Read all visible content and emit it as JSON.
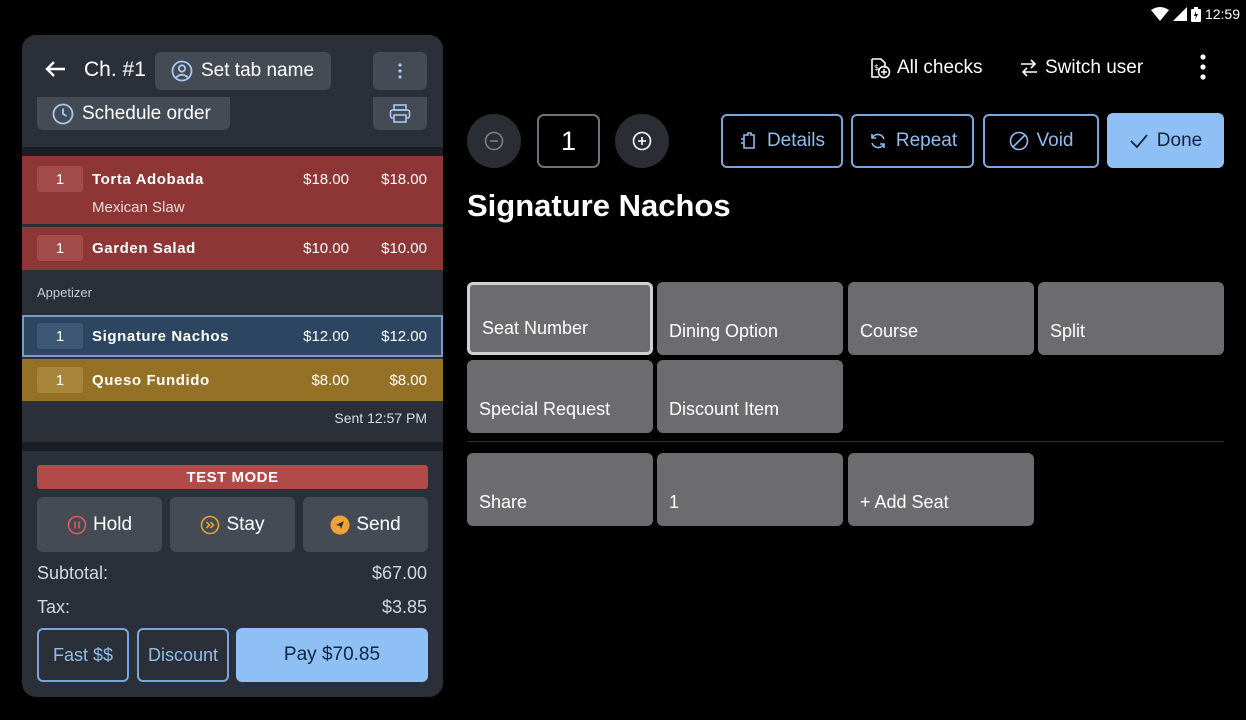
{
  "status_bar": {
    "time": "12:59"
  },
  "check": {
    "title": "Ch. #1",
    "set_tab_name_label": "Set tab name",
    "schedule_order_label": "Schedule order"
  },
  "order_items": [
    {
      "qty": "1",
      "name": "Torta Adobada",
      "modifier": "Mexican Slaw",
      "price": "$18.00",
      "total": "$18.00",
      "status_color": "#8e3535"
    },
    {
      "qty": "1",
      "name": "Garden Salad",
      "price": "$10.00",
      "total": "$10.00",
      "status_color": "#8e3535"
    },
    {
      "qty": "1",
      "name": "Signature Nachos",
      "price": "$12.00",
      "total": "$12.00",
      "status_color": "#2c4560"
    },
    {
      "qty": "1",
      "name": "Queso Fundido",
      "price": "$8.00",
      "total": "$8.00",
      "status_color": "#957126"
    }
  ],
  "category_label": "Appetizer",
  "sent_label": "Sent 12:57 PM",
  "test_mode_label": "TEST MODE",
  "actions": {
    "hold_label": "Hold",
    "stay_label": "Stay",
    "send_label": "Send"
  },
  "totals": {
    "subtotal_label": "Subtotal:",
    "subtotal_value": "$67.00",
    "tax_label": "Tax:",
    "tax_value": "$3.85"
  },
  "payment": {
    "fast_label": "Fast $$",
    "discount_label": "Discount",
    "pay_label": "Pay $70.85"
  },
  "top_bar": {
    "all_checks_label": "All checks",
    "switch_user_label": "Switch user"
  },
  "item_editor": {
    "quantity": "1",
    "details_label": "Details",
    "repeat_label": "Repeat",
    "void_label": "Void",
    "done_label": "Done",
    "item_title": "Signature Nachos"
  },
  "options": [
    {
      "label": "Seat Number",
      "selected": true
    },
    {
      "label": "Dining Option"
    },
    {
      "label": "Course"
    },
    {
      "label": "Split"
    },
    {
      "label": "Special Request"
    },
    {
      "label": "Discount Item"
    }
  ],
  "seats": [
    {
      "label": "Share"
    },
    {
      "label": "1"
    },
    {
      "label": "+ Add Seat"
    }
  ],
  "colors": {
    "accent": "#8fc0f5",
    "test_mode": "#b34a4a",
    "hold_icon": "#e05a5a",
    "stay_icon": "#e8a030",
    "send_icon": "#f0a23a"
  }
}
